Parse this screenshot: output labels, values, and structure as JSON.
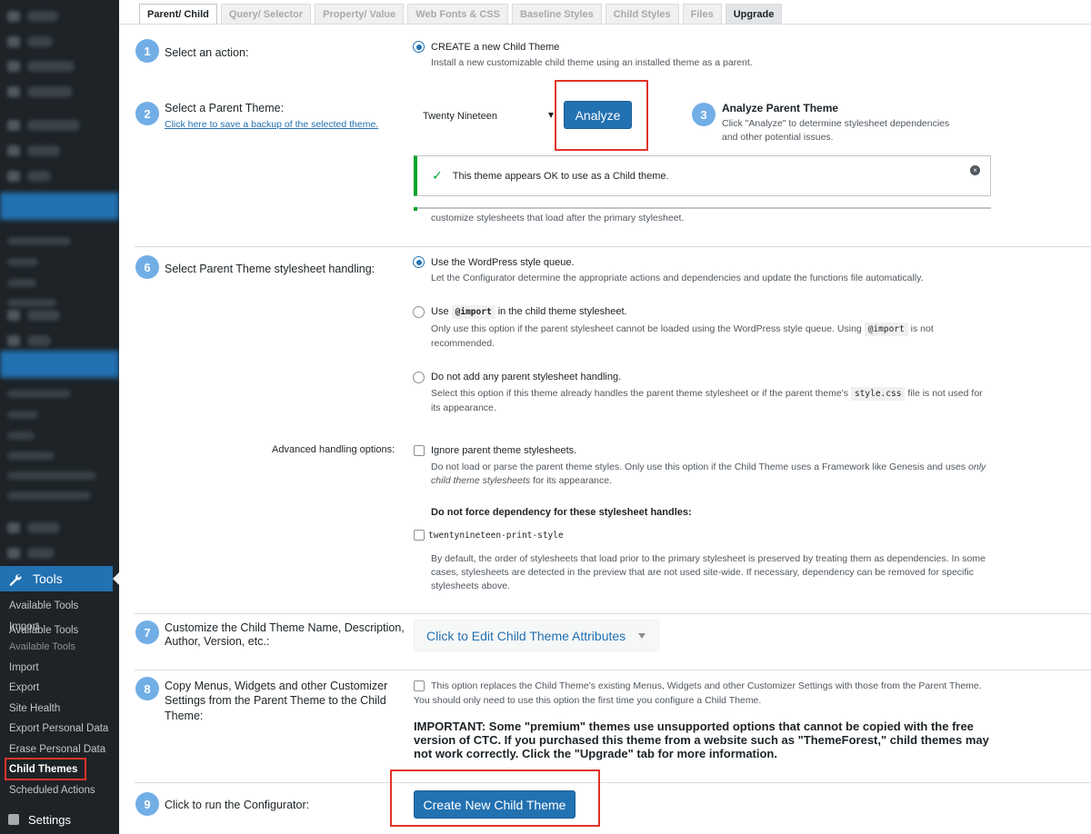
{
  "sidebar": {
    "tools_label": "Tools",
    "submenu": [
      "Available Tools",
      "Import",
      "Export",
      "Site Health",
      "Export Personal Data",
      "Erase Personal Data",
      "Child Themes",
      "Scheduled Actions"
    ],
    "overlap_ghost_1": "Import",
    "overlap_ghost_2": "Available Tools",
    "settings_label": "Settings"
  },
  "tabs": [
    "Parent/ Child",
    "Query/ Selector",
    "Property/ Value",
    "Web Fonts & CSS",
    "Baseline Styles",
    "Child Styles",
    "Files",
    "Upgrade"
  ],
  "steps": {
    "s1": {
      "num": "1",
      "label": "Select an action:",
      "option_title": "CREATE a new Child Theme",
      "option_desc": "Install a new customizable child theme using an installed theme as a parent."
    },
    "s2": {
      "num": "2",
      "label": "Select a Parent Theme:",
      "link": "Click here to save a backup of the selected theme.",
      "selected_theme": "Twenty Nineteen",
      "analyze_button": "Analyze"
    },
    "s3": {
      "num": "3",
      "title": "Analyze Parent Theme",
      "desc_1": "Click \"Analyze\" to determine stylesheet dependencies",
      "desc_2": "and other potential issues."
    },
    "notice": {
      "text": "This theme appears OK to use as a Child theme.",
      "below_text": "customize stylesheets that load after the primary stylesheet."
    },
    "s6": {
      "num": "6",
      "label": "Select Parent Theme stylesheet handling:",
      "opt1_title": "Use the WordPress style queue.",
      "opt1_desc": "Let the Configurator determine the appropriate actions and dependencies and update the functions file automatically.",
      "opt2_pre": "Use",
      "opt2_code": "@import",
      "opt2_post": "in the child theme stylesheet.",
      "opt2_desc_1": "Only use this option if the parent stylesheet cannot be loaded using the WordPress style queue. Using",
      "opt2_desc_code": "@import",
      "opt2_desc_2": "is not",
      "opt2_desc_3": "recommended.",
      "opt3_title": "Do not add any parent stylesheet handling.",
      "opt3_desc_1": "Select this option if this theme already handles the parent theme stylesheet or if the parent theme's",
      "opt3_desc_code": "style.css",
      "opt3_desc_2": "file is not used for",
      "opt3_desc_3": "its appearance."
    },
    "advanced": {
      "label": "Advanced handling options:",
      "ignore_title": "Ignore parent theme stylesheets.",
      "ignore_desc_1": "Do not load or parse the parent theme styles. Only use this option if the Child Theme uses a Framework like Genesis and uses",
      "ignore_desc_em1": "only",
      "ignore_desc_em2": "child theme stylesheets",
      "ignore_desc_2": "for its appearance.",
      "dep_title": "Do not force dependency for these stylesheet handles:",
      "handle": "twentynineteen-print-style",
      "dep_desc_1": "By default, the order of stylesheets that load prior to the primary stylesheet is preserved by treating them as dependencies. In some",
      "dep_desc_2": "cases, stylesheets are detected in the preview that are not used site-wide. If necessary, dependency can be removed for specific",
      "dep_desc_3": "stylesheets above."
    },
    "s7": {
      "num": "7",
      "label_1": "Customize the Child Theme Name, Description,",
      "label_2": "Author, Version, etc.:",
      "toggle": "Click to Edit Child Theme Attributes"
    },
    "s8": {
      "num": "8",
      "label_1": "Copy Menus, Widgets and other Customizer",
      "label_2": "Settings from the Parent Theme to the Child",
      "label_3": "Theme:",
      "check_text": "This option replaces the Child Theme's existing Menus, Widgets and other Customizer Settings with those from the Parent Theme.",
      "check_text_2": "You should only need to use this option the first time you configure a Child Theme.",
      "important_1": "IMPORTANT: Some \"premium\" themes use unsupported options that cannot be copied with the free",
      "important_2": "version of CTC. If you purchased this theme from a website such as \"ThemeForest,\" child themes may",
      "important_3": "not work correctly. Click the \"Upgrade\" tab for more information."
    },
    "s9": {
      "num": "9",
      "label": "Click to run the Configurator:",
      "button": "Create New Child Theme"
    }
  },
  "colors": {
    "primary": "#2271b1",
    "step_badge": "#72aee6",
    "success": "#00a32a",
    "highlight_box": "#e0332a",
    "sidebar_bg": "#1d2327"
  }
}
